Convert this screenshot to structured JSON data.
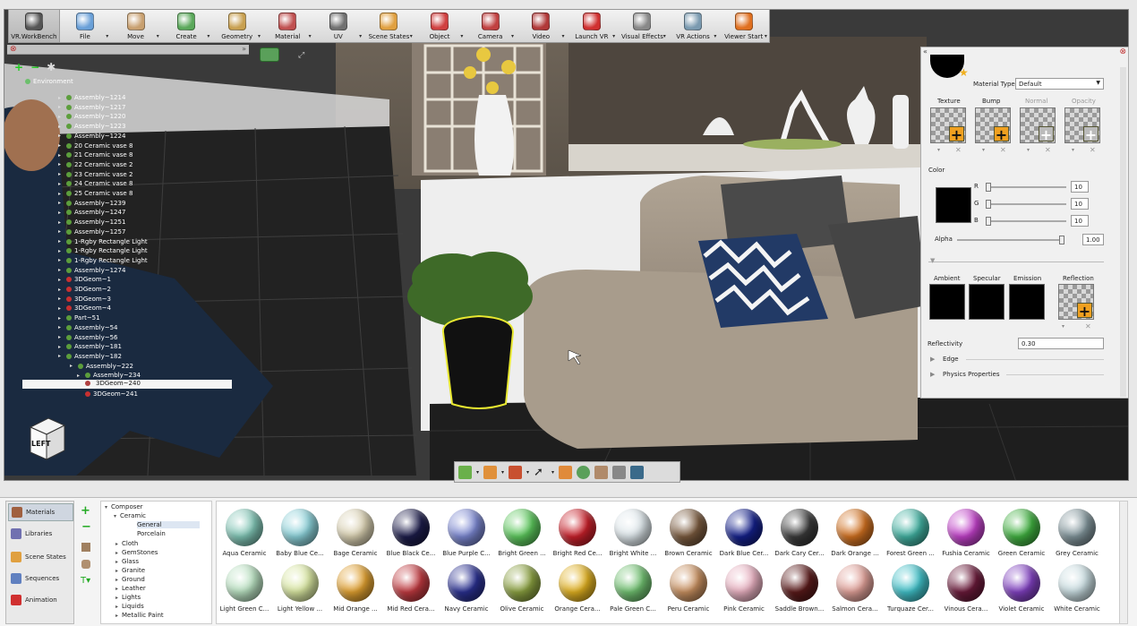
{
  "toolbar": {
    "items": [
      {
        "label": "VR.WorkBench",
        "color": "#555555"
      },
      {
        "label": "File",
        "color": "#6aa0d8"
      },
      {
        "label": "Move",
        "color": "#c8a070"
      },
      {
        "label": "Create",
        "color": "#5aa85a"
      },
      {
        "label": "Geometry",
        "color": "#c8a050"
      },
      {
        "label": "Material",
        "color": "#c05050"
      },
      {
        "label": "UV",
        "color": "#707070"
      },
      {
        "label": "Scene States",
        "color": "#e0a040"
      },
      {
        "label": "Object",
        "color": "#d04040"
      },
      {
        "label": "Camera",
        "color": "#c04040"
      },
      {
        "label": "Video",
        "color": "#b03838"
      },
      {
        "label": "Launch VR",
        "color": "#d03030"
      },
      {
        "label": "Visual Effects",
        "color": "#888888"
      },
      {
        "label": "VR Actions",
        "color": "#7a9ab0"
      },
      {
        "label": "Viewer Start",
        "color": "#e07020"
      }
    ]
  },
  "tree": {
    "root": "Environment",
    "items": [
      {
        "label": "Assembly~1214",
        "color": "#5c9e3c"
      },
      {
        "label": "Assembly~1217",
        "color": "#5c9e3c"
      },
      {
        "label": "Assembly~1220",
        "color": "#5c9e3c"
      },
      {
        "label": "Assembly~1223",
        "color": "#5c9e3c"
      },
      {
        "label": "Assembly~1224",
        "color": "#5c9e3c"
      },
      {
        "label": "20 Ceramic vase 8",
        "color": "#5c9e3c"
      },
      {
        "label": "21 Ceramic vase 8",
        "color": "#5c9e3c"
      },
      {
        "label": "22 Ceramic vase 2",
        "color": "#5c9e3c"
      },
      {
        "label": "23 Ceramic vase 2",
        "color": "#5c9e3c"
      },
      {
        "label": "24 Ceramic vase 8",
        "color": "#5c9e3c"
      },
      {
        "label": "25 Ceramic vase 8",
        "color": "#5c9e3c"
      },
      {
        "label": "Assembly~1239",
        "color": "#5c9e3c"
      },
      {
        "label": "Assembly~1247",
        "color": "#5c9e3c"
      },
      {
        "label": "Assembly~1251",
        "color": "#5c9e3c"
      },
      {
        "label": "Assembly~1257",
        "color": "#5c9e3c"
      },
      {
        "label": "1-Rgby Rectangle Light",
        "color": "#5c9e3c"
      },
      {
        "label": "1-Rgby Rectangle Light",
        "color": "#5c9e3c"
      },
      {
        "label": "1-Rgby Rectangle Light",
        "color": "#5c9e3c"
      },
      {
        "label": "Assembly~1274",
        "color": "#5c9e3c"
      },
      {
        "label": "3DGeom~1",
        "color": "#c83030"
      },
      {
        "label": "3DGeom~2",
        "color": "#c83030"
      },
      {
        "label": "3DGeom~3",
        "color": "#c83030"
      },
      {
        "label": "3DGeom~4",
        "color": "#c83030"
      },
      {
        "label": "Part~51",
        "color": "#5c9e3c"
      },
      {
        "label": "Assembly~54",
        "color": "#5c9e3c"
      },
      {
        "label": "Assembly~56",
        "color": "#5c9e3c"
      },
      {
        "label": "Assembly~181",
        "color": "#5c9e3c"
      },
      {
        "label": "Assembly~182",
        "color": "#5c9e3c"
      },
      {
        "label": "Assembly~222",
        "color": "#5c9e3c"
      },
      {
        "label": "Assembly~234",
        "color": "#5c9e3c"
      }
    ],
    "selected": "3DGeom~240",
    "after_selected": "3DGeom~241"
  },
  "navcube": {
    "face_label": "LEFT"
  },
  "material_panel": {
    "material_type_label": "Material Type",
    "material_type_value": "Default",
    "slots": [
      "Texture",
      "Bump",
      "Normal",
      "Opacity"
    ],
    "color_label": "Color",
    "channels": [
      {
        "name": "R",
        "value": "10"
      },
      {
        "name": "G",
        "value": "10"
      },
      {
        "name": "B",
        "value": "10"
      }
    ],
    "alpha_label": "Alpha",
    "alpha_value": "1.00",
    "swatches": [
      "Ambient",
      "Specular",
      "Emission",
      "Reflection"
    ],
    "reflectivity_label": "Reflectivity",
    "reflectivity_value": "0.30",
    "edge_label": "Edge",
    "physics_label": "Physics Properties"
  },
  "browser_nav": {
    "items": [
      {
        "label": "Materials",
        "color": "#a06040"
      },
      {
        "label": "Libraries",
        "color": "#7070b0"
      },
      {
        "label": "Scene States",
        "color": "#e0a040"
      },
      {
        "label": "Sequences",
        "color": "#6080c0"
      },
      {
        "label": "Animation",
        "color": "#d03030"
      }
    ]
  },
  "categories": {
    "root": "Composer",
    "group": "Ceramic",
    "selected": "General",
    "sub": "Porcelain",
    "items": [
      "Cloth",
      "GemStones",
      "Glass",
      "Granite",
      "Ground",
      "Leather",
      "Lights",
      "Liquids",
      "Metallic Paint"
    ]
  },
  "materials": {
    "row1": [
      {
        "label": "Aqua Ceramic",
        "color": "#7fc4b4"
      },
      {
        "label": "Baby Blue Ce...",
        "color": "#8ad0d8"
      },
      {
        "label": "Bage Ceramic",
        "color": "#d8cfb0"
      },
      {
        "label": "Blue Black Ce...",
        "color": "#1c1c4a"
      },
      {
        "label": "Blue Purple C...",
        "color": "#7a86d0"
      },
      {
        "label": "Bright Green ...",
        "color": "#5cc85c"
      },
      {
        "label": "Bright Red Ce...",
        "color": "#c8202a"
      },
      {
        "label": "Bright White ...",
        "color": "#dde6ea"
      },
      {
        "label": "Brown Ceramic",
        "color": "#7a5a3e"
      },
      {
        "label": "Dark Blue Cer...",
        "color": "#14208a"
      },
      {
        "label": "Dark Cary Cer...",
        "color": "#3a3a3a"
      },
      {
        "label": "Dark Orange ...",
        "color": "#d07020"
      },
      {
        "label": "Forest Green ...",
        "color": "#40b0a0"
      },
      {
        "label": "Fushia Ceramic",
        "color": "#c040c8"
      },
      {
        "label": "Green Ceramic",
        "color": "#40b040"
      },
      {
        "label": "Grey Ceramic",
        "color": "#80949a"
      }
    ],
    "row2": [
      {
        "label": "Light Green C...",
        "color": "#b8e0c0"
      },
      {
        "label": "Light Yellow ...",
        "color": "#d8e6a0"
      },
      {
        "label": "Mid Orange ...",
        "color": "#e0a030"
      },
      {
        "label": "Mid Red Cera...",
        "color": "#c03a40"
      },
      {
        "label": "Navy Ceramic",
        "color": "#2a3090"
      },
      {
        "label": "Olive Ceramic",
        "color": "#8aa040"
      },
      {
        "label": "Orange Cera...",
        "color": "#e0b020"
      },
      {
        "label": "Pale Green C...",
        "color": "#70c070"
      },
      {
        "label": "Peru Ceramic",
        "color": "#c89060"
      },
      {
        "label": "Pink Ceramic",
        "color": "#e8b0c0"
      },
      {
        "label": "Saddle Brown...",
        "color": "#5a1a1a"
      },
      {
        "label": "Salmon Cera...",
        "color": "#e0a098"
      },
      {
        "label": "Turquaze Cer...",
        "color": "#40c0c8"
      },
      {
        "label": "Vinous Cera...",
        "color": "#6a1a3a"
      },
      {
        "label": "Violet Ceramic",
        "color": "#8040c0"
      },
      {
        "label": "White Ceramic",
        "color": "#c8dce0"
      }
    ]
  },
  "colors": {
    "accent": "#f0a020",
    "selection_outline": "#e8e830"
  }
}
